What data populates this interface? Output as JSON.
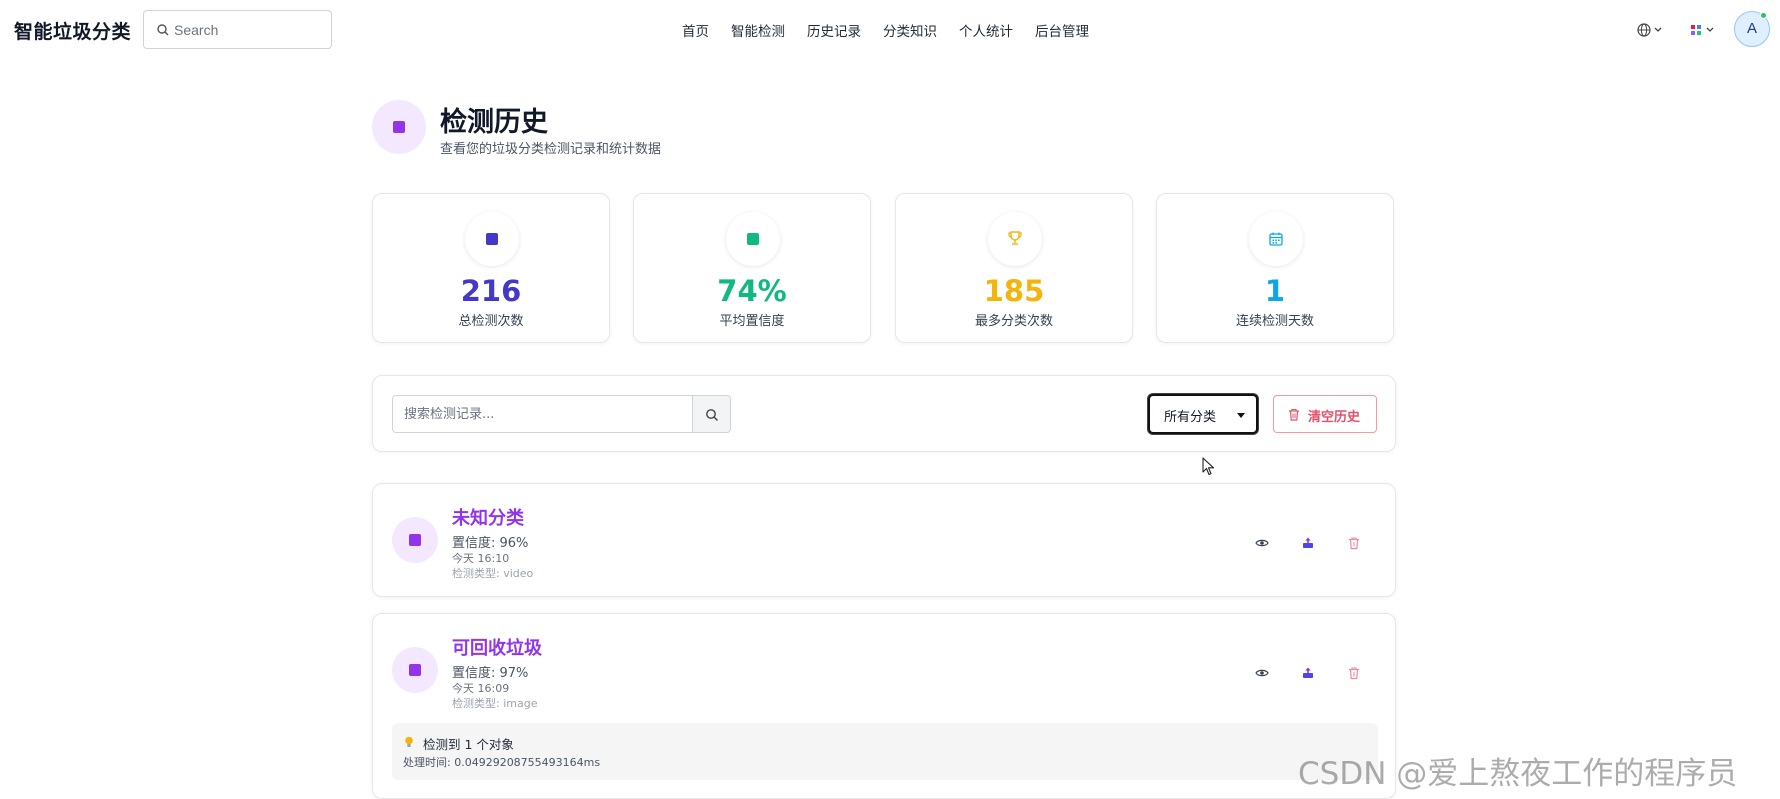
{
  "app": {
    "brand": "智能垃圾分类"
  },
  "topbar": {
    "search_placeholder": "Search",
    "nav": [
      "首页",
      "智能检测",
      "历史记录",
      "分类知识",
      "个人统计",
      "后台管理"
    ],
    "avatar_initial": "A",
    "globe_icon": "globe-icon",
    "apps_icon": "apps-grid-icon"
  },
  "header": {
    "title": "检测历史",
    "subtitle": "查看您的垃圾分类检测记录和统计数据"
  },
  "stats": [
    {
      "value": "216",
      "label": "总检测次数",
      "color": "#4338ca",
      "icon": "chart-icon"
    },
    {
      "value": "74%",
      "label": "平均置信度",
      "color": "#10b981",
      "icon": "trend-icon"
    },
    {
      "value": "185",
      "label": "最多分类次数",
      "color": "#f5b40b",
      "icon": "trophy-icon"
    },
    {
      "value": "1",
      "label": "连续检测天数",
      "color": "#0ea5e9",
      "icon": "calendar-icon"
    }
  ],
  "filter": {
    "search_placeholder": "搜索检测记录...",
    "select_value": "所有分类",
    "clear_label": "清空历史"
  },
  "records": [
    {
      "title": "未知分类",
      "confidence": "置信度: 96%",
      "time": "今天 16:10",
      "type": "检测类型: video"
    },
    {
      "title": "可回收垃圾",
      "confidence": "置信度: 97%",
      "time": "今天 16:09",
      "type": "检测类型: image",
      "detail_line1": "检测到 1 个对象",
      "detail_line2": "处理时间: 0.04929208755493164ms"
    }
  ],
  "watermark": "CSDN @爱上熬夜工作的程序员",
  "colors": {
    "accent_purple": "#9333ea",
    "danger": "#e5506a"
  }
}
